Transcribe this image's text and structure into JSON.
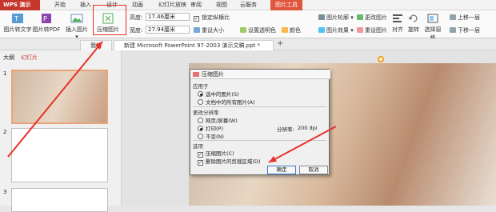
{
  "menubar": {
    "app": "WPS 演示",
    "items": [
      "开始",
      "插入",
      "设计",
      "动画",
      "幻灯片放映",
      "审阅",
      "视图",
      "云服务",
      "图片工具"
    ],
    "active": "图片工具"
  },
  "ribbon": {
    "pic_to_text": "图片转文字",
    "pic_to_pdf": "图片转PDF",
    "insert_pic": "插入图片 ▾",
    "compress": "压缩图片",
    "height_label": "高度:",
    "height_value": "17.46厘米",
    "width_label": "宽度:",
    "width_value": "27.94厘米",
    "lock_ratio": "锁定纵横比",
    "reset_size": "重设大小",
    "set_transparent": "设置透明色",
    "color": "颜色",
    "pic_outline": "图片轮廓 ▾",
    "pic_effect": "图片效果 ▾",
    "change_pic": "更改图片",
    "reset_pic": "重设图片",
    "align": "对齐",
    "rotate": "旋转",
    "selection_pane": "选择窗格",
    "group": "组合",
    "bring_forward": "上移一层",
    "send_backward": "下移一层"
  },
  "tabs": {
    "wps": "我的WPS",
    "doc": "新建 Microsoft PowerPoint 97-2003 演示文稿.ppt *",
    "add": "+"
  },
  "panel": {
    "outline_tab": "大纲",
    "slides_tab": "幻灯片",
    "slide_numbers": [
      "1",
      "2",
      "3"
    ]
  },
  "dialog": {
    "title": "压缩图片",
    "apply_to": "应用于",
    "opt_selected": "选中的图片(S)",
    "opt_all": "文档中的所有图片(A)",
    "change_res": "更改分辨率",
    "opt_web": "网页/屏幕(W)",
    "opt_print": "打印(P)",
    "opt_none": "不变(N)",
    "resolution_label": "分辨率:",
    "resolution_value": "200 dpi",
    "options": "选项",
    "compress_pic": "压缩图片(C)",
    "delete_crop": "删除图片的剪裁区域(D)",
    "ok": "确定",
    "cancel": "取消"
  },
  "colors": {
    "accent": "#c6372b",
    "annotation": "#e8302a"
  }
}
